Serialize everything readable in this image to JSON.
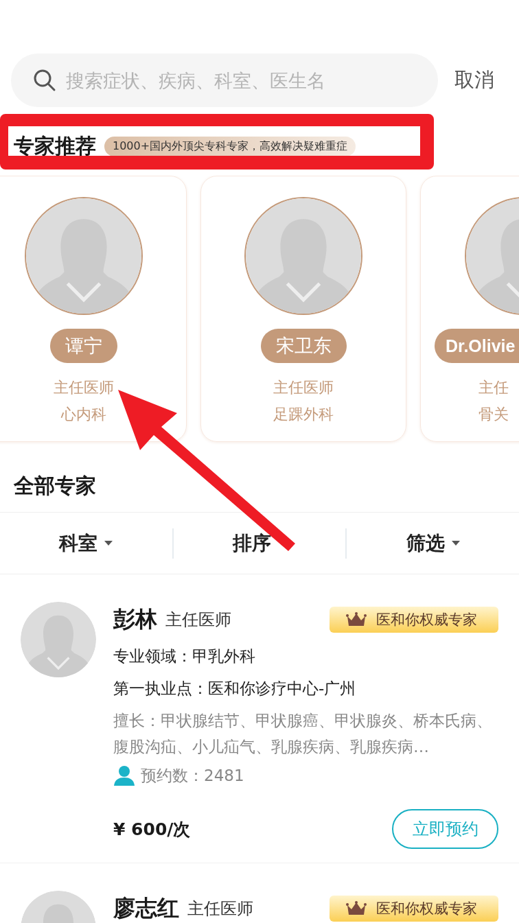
{
  "search": {
    "placeholder": "搜索症状、疾病、科室、医生名",
    "cancel": "取消"
  },
  "recommend": {
    "title": "专家推荐",
    "tagline": "1000+国内外顶尖专科专家，高效解决疑难重症",
    "doctors": [
      {
        "name": "谭宁",
        "title": "主任医师",
        "department": "心内科"
      },
      {
        "name": "宋卫东",
        "title": "主任医师",
        "department": "足踝外科"
      },
      {
        "name": "Dr.Olivie",
        "title": "主任",
        "department": "骨关"
      }
    ]
  },
  "experts": {
    "title": "全部专家",
    "filters": [
      {
        "label": "科室"
      },
      {
        "label": "排序"
      },
      {
        "label": "筛选"
      }
    ],
    "doctors": [
      {
        "name": "彭林",
        "title": "主任医师",
        "badge": "医和你权威专家",
        "field": "专业领域：甲乳外科",
        "location": "第一执业点：医和你诊疗中心-广州",
        "specialty": "擅长：甲状腺结节、甲状腺癌、甲状腺炎、桥本氏病、腹股沟疝、小儿疝气、乳腺疾病、乳腺疾病…",
        "appointments": "预约数：2481",
        "price": "¥ 600/次",
        "action": "立即预约"
      },
      {
        "name": "廖志红",
        "title": "主任医师",
        "badge": "医和你权威专家"
      }
    ]
  },
  "annotations": {
    "highlight_frame": true,
    "arrow": true
  }
}
